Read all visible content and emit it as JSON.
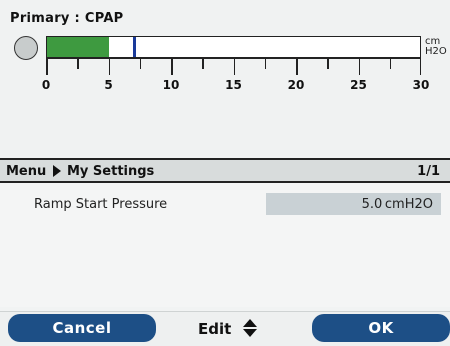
{
  "pressure_panel": {
    "title": "Primary : CPAP",
    "unit_line1": "cm",
    "unit_line2": "H2O",
    "scale": {
      "min": 0,
      "max": 30,
      "labels": [
        "0",
        "5",
        "10",
        "15",
        "20",
        "25",
        "30"
      ]
    },
    "current_value": 5.0,
    "marker_value": 7.0,
    "fill_color": "#3e9a40",
    "marker_color": "#1a3a9a"
  },
  "menu": {
    "title": "Menu",
    "subtitle": "My Settings",
    "page": "1/1"
  },
  "settings": [
    {
      "label": "Ramp Start Pressure",
      "value": "5.0 cmH2O"
    }
  ],
  "softkeys": {
    "cancel": "Cancel",
    "edit": "Edit",
    "ok": "OK",
    "accent": "#1d4f86"
  }
}
